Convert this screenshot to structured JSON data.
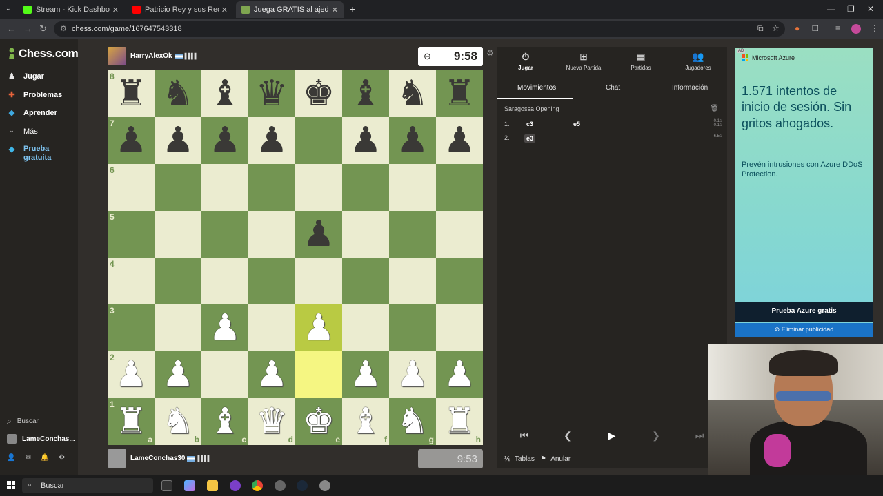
{
  "browser": {
    "tabs": [
      {
        "label": "Stream - Kick Dashboard",
        "color": "#53fc18"
      },
      {
        "label": "Patricio Rey y sus Redondit",
        "color": "#ff0000"
      },
      {
        "label": "Juega GRATIS al ajedrez on",
        "color": "#7fa650"
      }
    ],
    "url": "chess.com/game/167647543318"
  },
  "sidebar": {
    "logo": "Chess.com",
    "items": [
      {
        "label": "Jugar",
        "icon": "pawn-icon"
      },
      {
        "label": "Problemas",
        "icon": "puzzle-icon"
      },
      {
        "label": "Aprender",
        "icon": "learn-icon"
      },
      {
        "label": "Más",
        "icon": "chevron-down-icon"
      },
      {
        "label": "Prueba gratuita",
        "icon": "diamond-icon"
      }
    ],
    "search": "Buscar",
    "user": "LameConchas..."
  },
  "game": {
    "top_player": "HarryAlexOk",
    "top_clock": "9:58",
    "bottom_player": "LameConchas30",
    "bottom_clock": "9:53",
    "ranks": [
      "8",
      "7",
      "6",
      "5",
      "4",
      "3",
      "2",
      "1"
    ],
    "files": [
      "a",
      "b",
      "c",
      "d",
      "e",
      "f",
      "g",
      "h"
    ]
  },
  "panel": {
    "tabs": [
      "Jugar",
      "Nueva Partida",
      "Partidas",
      "Jugadores"
    ],
    "subtabs": [
      "Movimientos",
      "Chat",
      "Información"
    ],
    "opening": "Saragossa Opening",
    "moves": [
      {
        "num": "1.",
        "white": "c3",
        "black": "e5",
        "t1": "0.1s",
        "t2": "0.1s"
      },
      {
        "num": "2.",
        "white": "e3",
        "black": "",
        "t1": "6.5s",
        "t2": ""
      }
    ],
    "draw_label": "Tablas",
    "abort_label": "Anular"
  },
  "ad": {
    "brand": "Microsoft Azure",
    "headline": "1.571 intentos de inicio de sesión. Sin gritos ahogados.",
    "sub": "Prevén intrusiones con Azure DDoS Protection.",
    "cta": "Prueba Azure gratis",
    "remove": "Eliminar publicidad",
    "badge": "AD"
  },
  "taskbar": {
    "search": "Buscar"
  }
}
